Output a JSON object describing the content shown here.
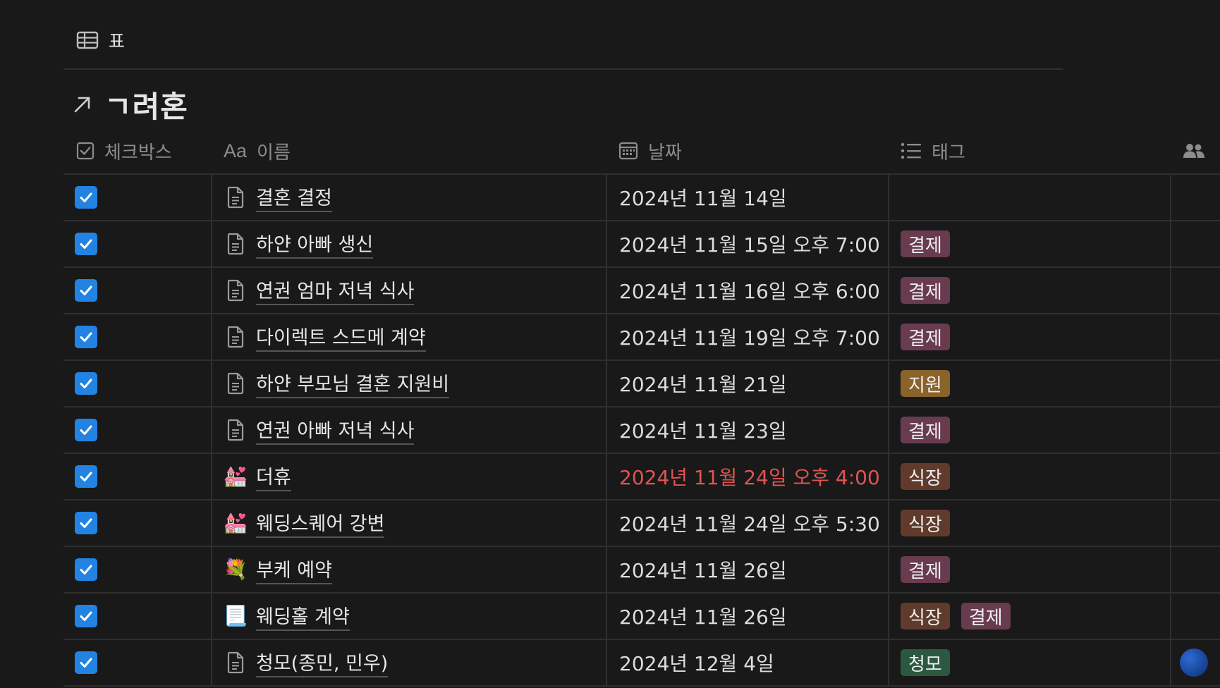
{
  "view": {
    "icon": "table-icon",
    "label": "표"
  },
  "database": {
    "icon": "arrow-up-right-icon",
    "title": "ㄱ려혼"
  },
  "columns": {
    "checkbox": {
      "icon": "checkbox-icon",
      "label": "체크박스"
    },
    "name": {
      "icon": "text-aa-icon",
      "icon_text": "Aa",
      "label": "이름"
    },
    "date": {
      "icon": "calendar-icon",
      "label": "날짜"
    },
    "tags": {
      "icon": "list-icon",
      "label": "태그"
    },
    "people": {
      "icon": "people-icon",
      "label": ""
    }
  },
  "tag_colors": {
    "결제": "#693b4f",
    "지원": "#89632a",
    "식장": "#603b2c",
    "청모": "#2b593f"
  },
  "rows": [
    {
      "checked": true,
      "icon": "page-icon",
      "name": "결혼 결정",
      "date": "2024년 11월 14일",
      "overdue": false,
      "tags": []
    },
    {
      "checked": true,
      "icon": "page-icon",
      "name": "하얀 아빠 생신",
      "date": "2024년 11월 15일 오후 7:00",
      "overdue": false,
      "tags": [
        "결제"
      ]
    },
    {
      "checked": true,
      "icon": "page-icon",
      "name": "연권 엄마 저녁 식사",
      "date": "2024년 11월 16일 오후 6:00",
      "overdue": false,
      "tags": [
        "결제"
      ]
    },
    {
      "checked": true,
      "icon": "page-icon",
      "name": "다이렉트 스드메 계약",
      "date": "2024년 11월 19일 오후 7:00",
      "overdue": false,
      "tags": [
        "결제"
      ]
    },
    {
      "checked": true,
      "icon": "page-icon",
      "name": "하얀 부모님 결혼 지원비",
      "date": "2024년 11월 21일",
      "overdue": false,
      "tags": [
        "지원"
      ]
    },
    {
      "checked": true,
      "icon": "page-icon",
      "name": "연권 아빠 저녁 식사",
      "date": "2024년 11월 23일",
      "overdue": false,
      "tags": [
        "결제"
      ]
    },
    {
      "checked": true,
      "icon": "wedding-chapel-icon",
      "emoji": "💒",
      "name": "더휴",
      "date": "2024년 11월 24일 오후 4:00",
      "overdue": true,
      "tags": [
        "식장"
      ]
    },
    {
      "checked": true,
      "icon": "wedding-chapel-icon",
      "emoji": "💒",
      "name": "웨딩스퀘어 강변",
      "date": "2024년 11월 24일 오후 5:30",
      "overdue": false,
      "tags": [
        "식장"
      ]
    },
    {
      "checked": true,
      "icon": "bouquet-icon",
      "emoji": "💐",
      "name": "부케 예약",
      "date": "2024년 11월 26일",
      "overdue": false,
      "tags": [
        "결제"
      ]
    },
    {
      "checked": true,
      "icon": "scroll-icon",
      "emoji": "📃",
      "name": "웨딩홀 계약",
      "date": "2024년 11월 26일",
      "overdue": false,
      "tags": [
        "식장",
        "결제"
      ]
    },
    {
      "checked": true,
      "icon": "page-icon",
      "name": "청모(종민, 민우)",
      "date": "2024년 12월 4일",
      "overdue": false,
      "tags": [
        "청모"
      ],
      "has_avatar": true
    }
  ]
}
